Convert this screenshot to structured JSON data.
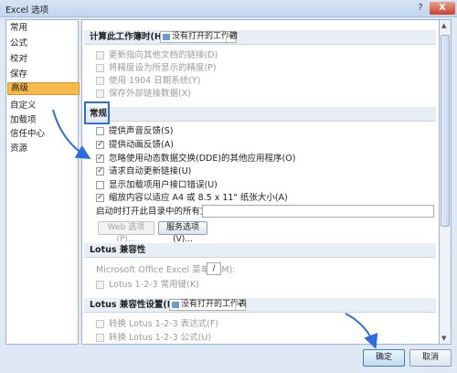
{
  "window": {
    "title": "Excel 选项",
    "help_glyph": "?",
    "close_glyph": "X"
  },
  "sidebar": {
    "items": [
      {
        "label": "常用"
      },
      {
        "label": "公式"
      },
      {
        "label": "校对"
      },
      {
        "label": "保存"
      },
      {
        "label": "高级",
        "active": true
      },
      {
        "label": "自定义"
      },
      {
        "label": "加载项"
      },
      {
        "label": "信任中心"
      },
      {
        "label": "资源"
      }
    ]
  },
  "calc_section": {
    "heading": "计算此工作簿时(H):",
    "dropdown_value": "没有打开的工作簿",
    "options": [
      {
        "label": "更新指向其他文档的链接(D)",
        "checked": false,
        "disabled": true
      },
      {
        "label": "将精度设为所显示的精度(P)",
        "checked": false,
        "disabled": true
      },
      {
        "label": "使用 1904 日期系统(Y)",
        "checked": false,
        "disabled": true
      },
      {
        "label": "保存外部链接数据(X)",
        "checked": false,
        "disabled": true
      }
    ]
  },
  "general_section": {
    "heading": "常规",
    "options": [
      {
        "label": "提供声音反馈(S)",
        "checked": false
      },
      {
        "label": "提供动画反馈(A)",
        "checked": true
      },
      {
        "label": "忽略使用动态数据交换(DDE)的其他应用程序(O)",
        "checked": true
      },
      {
        "label": "请求自动更新链接(U)",
        "checked": true
      },
      {
        "label": "显示加载项用户接口错误(U)",
        "checked": false
      },
      {
        "label": "缩放内容以适应 A4 或 8.5 x 11\" 纸张大小(A)",
        "checked": true
      }
    ],
    "startup_label": "启动时打开此目录中的所有文件(L):",
    "startup_value": "",
    "web_options_label": "Web 选项(P)...",
    "service_options_label": "服务选项(V)..."
  },
  "lotus_section": {
    "heading": "Lotus 兼容性",
    "menu_key_label": "Microsoft Office Excel 菜单键(M):",
    "menu_key_value": "/",
    "nav_keys_label": "Lotus 1-2-3 常用键(K)"
  },
  "lotus_settings_section": {
    "heading": "Lotus 兼容性设置(L):",
    "dropdown_value": "没有打开的工作表",
    "options": [
      {
        "label": "转换 Lotus 1-2-3 表达式(F)",
        "checked": false,
        "disabled": true
      },
      {
        "label": "转换 Lotus 1-2-3 公式(U)",
        "checked": false,
        "disabled": true
      }
    ]
  },
  "footer": {
    "ok_label": "确定",
    "cancel_label": "取消"
  },
  "colors": {
    "accent": "#2d6cdf",
    "selected_item": "#f6b94c",
    "section_bg": "#e8eef6"
  },
  "icons": {
    "dropdown": "workbook-icon",
    "scroll_up": "up-arrow-icon",
    "scroll_down": "down-arrow-icon"
  }
}
